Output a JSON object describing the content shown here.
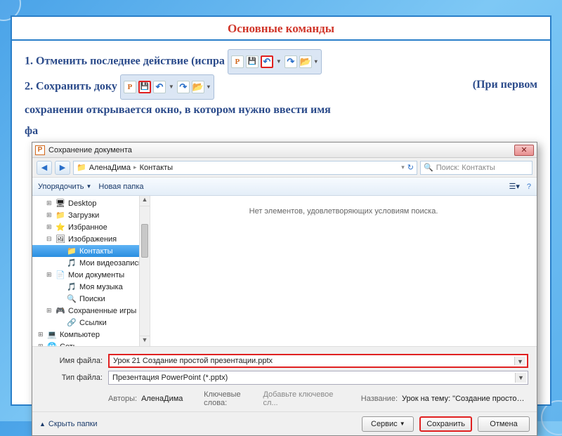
{
  "header": {
    "title": "Основные команды"
  },
  "text": {
    "line1_prefix": "1. Отменить последнее действие (испра",
    "line2_prefix": "2. Сохранить доку",
    "line2_suffix": "(При первом",
    "line3": "сохранении открывается окно, в котором нужно ввести имя",
    "line4": "фа"
  },
  "dialog": {
    "title": "Сохранение документа",
    "breadcrumb": {
      "seg1": "АленаДима",
      "seg2": "Контакты"
    },
    "search_placeholder": "Поиск: Контакты",
    "toolbar": {
      "organize": "Упорядочить",
      "newfolder": "Новая папка"
    },
    "empty_msg": "Нет элементов, удовлетворяющих условиям поиска.",
    "tree": [
      {
        "lvl": 1,
        "exp": "⊞",
        "icon": "🖥",
        "label": "Desktop"
      },
      {
        "lvl": 1,
        "exp": "⊞",
        "icon": "📁",
        "label": "Загрузки"
      },
      {
        "lvl": 1,
        "exp": "⊞",
        "icon": "⭐",
        "label": "Избранное"
      },
      {
        "lvl": 1,
        "exp": "⊟",
        "icon": "🖼",
        "label": "Изображения"
      },
      {
        "lvl": 2,
        "exp": "",
        "icon": "📁",
        "label": "Контакты",
        "selected": true
      },
      {
        "lvl": 2,
        "exp": "",
        "icon": "🎵",
        "label": "Мои видеозаписи"
      },
      {
        "lvl": 1,
        "exp": "⊞",
        "icon": "📄",
        "label": "Мои документы"
      },
      {
        "lvl": 2,
        "exp": "",
        "icon": "🎵",
        "label": "Моя музыка"
      },
      {
        "lvl": 2,
        "exp": "",
        "icon": "🔍",
        "label": "Поиски"
      },
      {
        "lvl": 1,
        "exp": "⊞",
        "icon": "🎮",
        "label": "Сохраненные игры"
      },
      {
        "lvl": 2,
        "exp": "",
        "icon": "🔗",
        "label": "Ссылки"
      },
      {
        "lvl": 0,
        "exp": "⊞",
        "icon": "💻",
        "label": "Компьютер"
      },
      {
        "lvl": 0,
        "exp": "⊞",
        "icon": "🌐",
        "label": "Сеть"
      }
    ],
    "filename_label": "Имя файла:",
    "filename_value": "Урок 21 Создание простой презентации.pptx",
    "filetype_label": "Тип файла:",
    "filetype_value": "Презентация PowerPoint (*.pptx)",
    "meta": {
      "authors_label": "Авторы:",
      "authors_value": "АленаДима",
      "keywords_label": "Ключевые слова:",
      "keywords_placeholder": "Добавьте ключевое сл...",
      "title_label": "Название:",
      "title_value": "Урок на тему: \"Создание простой презентации\""
    },
    "footer": {
      "hide_folders": "Скрыть папки",
      "service": "Сервис",
      "save": "Сохранить",
      "cancel": "Отмена"
    }
  }
}
